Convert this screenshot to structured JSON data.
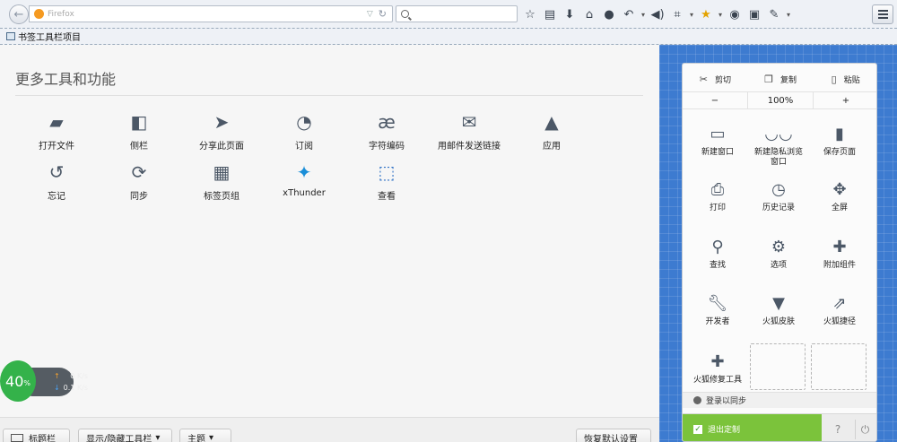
{
  "navbar": {
    "url_placeholder": "Firefox",
    "icons": [
      "star-icon",
      "reading-list-icon",
      "download-icon",
      "home-icon",
      "chat-icon",
      "reply-icon",
      "volume-icon",
      "crop-icon",
      "addon-icon",
      "speech-icon",
      "screenshot-icon",
      "pen-icon"
    ]
  },
  "bookmarks": {
    "label": "书签工具栏项目"
  },
  "palette": {
    "title": "更多工具和功能",
    "tools": [
      {
        "label": "打开文件",
        "icon": "folder-icon"
      },
      {
        "label": "侧栏",
        "icon": "sidebar-icon"
      },
      {
        "label": "分享此页面",
        "icon": "share-icon"
      },
      {
        "label": "订阅",
        "icon": "rss-icon"
      },
      {
        "label": "字符编码",
        "icon": "encoding-icon"
      },
      {
        "label": "用邮件发送链接",
        "icon": "email-icon"
      },
      {
        "label": "应用",
        "icon": "rocket-icon"
      },
      {
        "label": "忘记",
        "icon": "forget-icon"
      },
      {
        "label": "同步",
        "icon": "sync-icon"
      },
      {
        "label": "标签页组",
        "icon": "tab-groups-icon"
      },
      {
        "label": "xThunder",
        "icon": "xthunder-icon"
      },
      {
        "label": "查看",
        "icon": "view-icon"
      }
    ]
  },
  "bottom": {
    "title_bar": "标题栏",
    "toolbars": "显示/隐藏工具栏",
    "themes": "主题",
    "restore": "恢复默认设置"
  },
  "speed": {
    "percent": "40",
    "unit": "%",
    "up": "0",
    "down": "0.1",
    "rate_unit": "K/s"
  },
  "menu": {
    "edit": {
      "cut": "剪切",
      "copy": "复制",
      "paste": "粘贴"
    },
    "zoom": {
      "minus": "−",
      "level": "100%",
      "plus": "+"
    },
    "items": [
      {
        "label": "新建窗口",
        "icon": "new-window-icon"
      },
      {
        "label": "新建隐私浏览\n窗口",
        "icon": "mask-icon"
      },
      {
        "label": "保存页面",
        "icon": "save-page-icon"
      },
      {
        "label": "打印",
        "icon": "print-icon"
      },
      {
        "label": "历史记录",
        "icon": "history-icon"
      },
      {
        "label": "全屏",
        "icon": "fullscreen-icon"
      },
      {
        "label": "查找",
        "icon": "find-icon"
      },
      {
        "label": "选项",
        "icon": "gear-icon"
      },
      {
        "label": "附加组件",
        "icon": "puzzle-icon"
      },
      {
        "label": "开发者",
        "icon": "wrench-icon"
      },
      {
        "label": "火狐皮肤",
        "icon": "shirt-icon"
      },
      {
        "label": "火狐捷径",
        "icon": "shortcut-icon"
      },
      {
        "label": "火狐修复工具",
        "icon": "repair-icon"
      }
    ],
    "sync_label": "登录以同步",
    "exit_customize": "退出定制",
    "help": "?",
    "quit": "⏻"
  }
}
